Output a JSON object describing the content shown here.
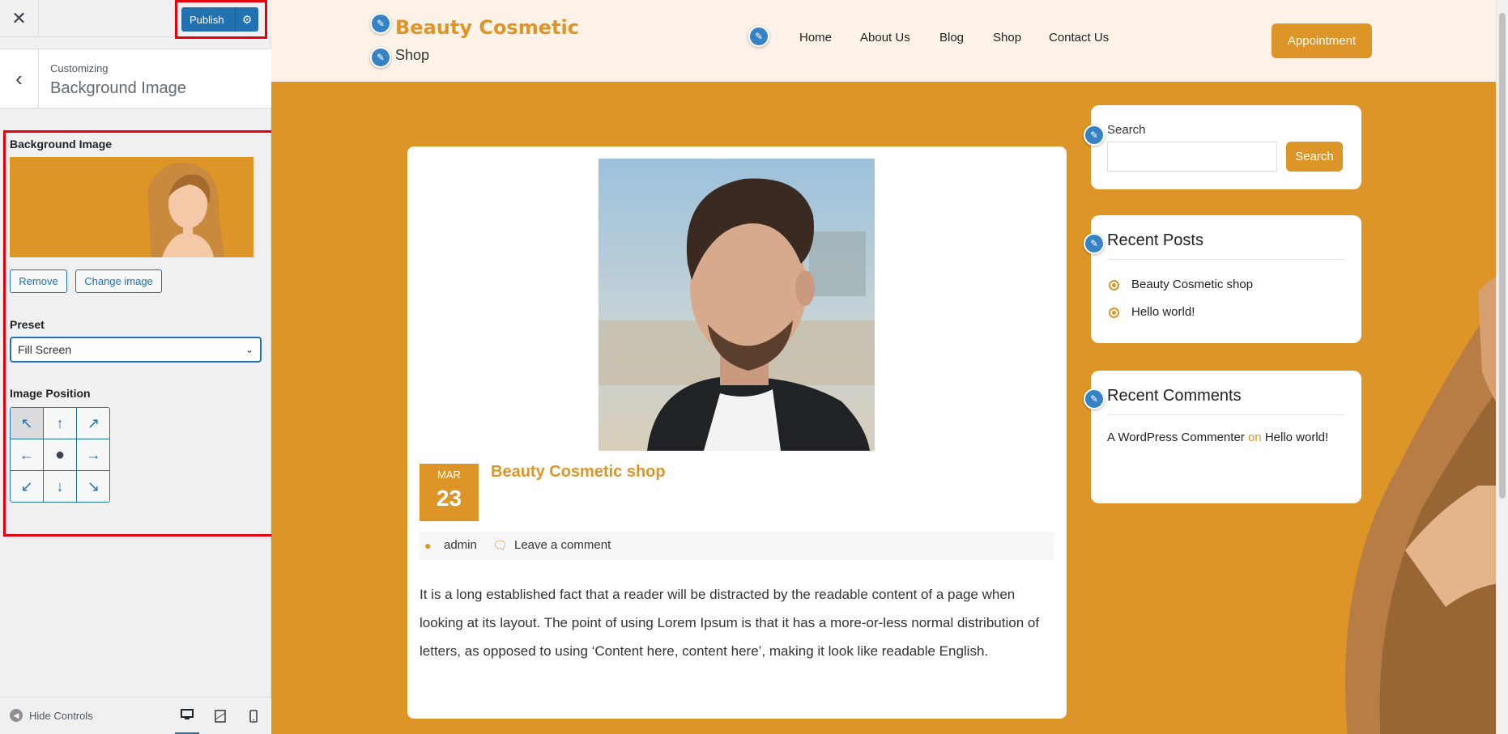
{
  "sidebar": {
    "close_glyph": "✕",
    "publish_label": "Publish",
    "gear_glyph": "⚙",
    "back_glyph": "‹",
    "crumb_small": "Customizing",
    "crumb_title": "Background Image",
    "bg_label": "Background Image",
    "remove_label": "Remove",
    "change_label": "Change image",
    "preset_label": "Preset",
    "preset_value": "Fill Screen",
    "chevron_glyph": "⌄",
    "position_label": "Image Position",
    "position_cells": [
      "↖",
      "↑",
      "↗",
      "←",
      "●",
      "→",
      "↙",
      "↓",
      "↘"
    ],
    "hide_controls": "Hide Controls"
  },
  "site": {
    "title": "Beauty Cosmetic",
    "tagline": "Shop",
    "nav": [
      "Home",
      "About Us",
      "Blog",
      "Shop",
      "Contact Us"
    ],
    "appointment": "Appointment",
    "pencil_glyph": "✎"
  },
  "post": {
    "month": "MAR",
    "day": "23",
    "title": "Beauty Cosmetic shop",
    "author": "admin",
    "comment_link": "Leave a comment",
    "excerpt": "It is a long established fact that a reader will be distracted by the readable content of a page when looking at its layout. The point of using Lorem Ipsum is that it has a more-or-less normal distribution of letters, as opposed to using ‘Content here, content here’, making it look like readable English."
  },
  "widgets": {
    "search_label": "Search",
    "search_button": "Search",
    "recent_posts_title": "Recent Posts",
    "recent_posts": [
      "Beauty Cosmetic shop",
      "Hello world!"
    ],
    "recent_comments_title": "Recent Comments",
    "comment_author": "A WordPress Commenter",
    "comment_on": "on",
    "comment_post": "Hello world!"
  },
  "colors": {
    "accent": "#dd9527",
    "wp_blue": "#2271b1",
    "highlight_red": "#e3000f",
    "header_bg": "#fcf2e8"
  }
}
